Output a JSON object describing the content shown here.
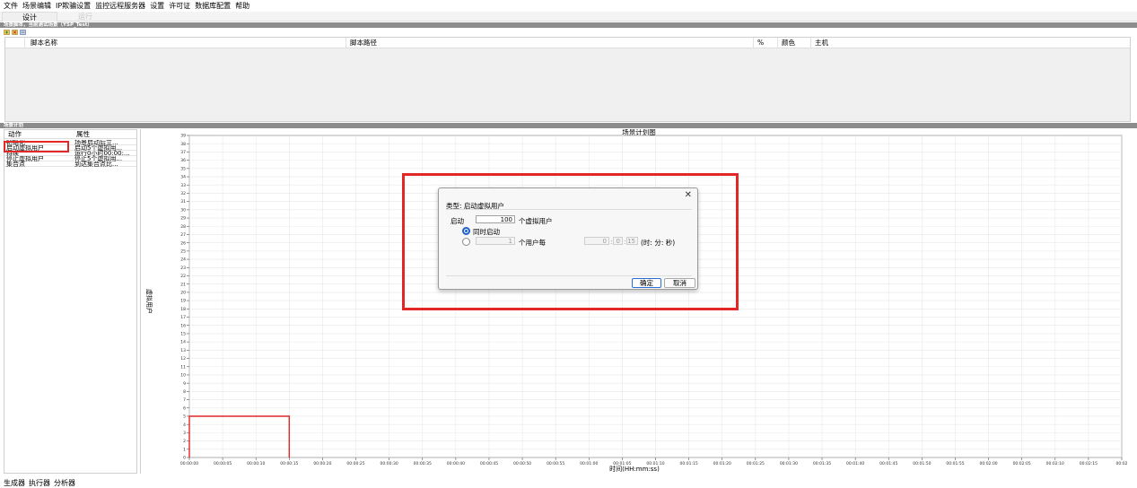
{
  "menu": [
    "文件",
    "场景编辑",
    "IP欺骗设置",
    "监控远程服务器",
    "设置",
    "许可证",
    "数据库配置",
    "帮助"
  ],
  "top_tabs": {
    "design": "设计",
    "run": "运行"
  },
  "script_section": {
    "header": "场景脚本，当前测试场景（YSP_Test）",
    "columns": [
      "脚本名称",
      "脚本路径",
      "%",
      "颜色",
      "主机"
    ]
  },
  "plan_section": {
    "header": "场景计划",
    "columns": {
      "action": "动作",
      "property": "属性"
    },
    "rows": [
      {
        "action": "初始化",
        "property": "场景启动后立..."
      },
      {
        "action": "启动虚拟用户",
        "property": "启动5个虚拟用..."
      },
      {
        "action": "持续",
        "property": "运行0小时00:00:..."
      },
      {
        "action": "停止虚拟用户",
        "property": "停止5个虚拟用..."
      },
      {
        "action": "集合点",
        "property": "到达集合点比..."
      }
    ]
  },
  "chart": {
    "title": "场景计划图",
    "ylabel": "虚拟用户",
    "xlabel": "时间(HH:mm:ss)"
  },
  "chart_data": {
    "type": "line",
    "title": "场景计划图",
    "xlabel": "时间(HH:mm:ss)",
    "ylabel": "虚拟用户",
    "ylim": [
      0,
      39
    ],
    "yticks": [
      0,
      1,
      2,
      3,
      4,
      5,
      6,
      7,
      8,
      9,
      10,
      11,
      12,
      13,
      14,
      15,
      16,
      17,
      18,
      19,
      20,
      21,
      22,
      23,
      24,
      25,
      26,
      27,
      28,
      29,
      30,
      31,
      32,
      33,
      34,
      35,
      36,
      37,
      38,
      39
    ],
    "xticks": [
      "00:00:00",
      "00:00:05",
      "00:00:10",
      "00:00:15",
      "00:00:20",
      "00:00:25",
      "00:00:30",
      "00:00:35",
      "00:00:40",
      "00:00:45",
      "00:00:50",
      "00:00:55",
      "00:01:00",
      "00:01:05",
      "00:01:10",
      "00:01:15",
      "00:01:20",
      "00:01:25",
      "00:01:30",
      "00:01:35",
      "00:01:40",
      "00:01:45",
      "00:01:50",
      "00:01:55",
      "00:02:00",
      "00:02:05",
      "00:02:10",
      "00:02:15",
      "00:02"
    ],
    "grid": true,
    "series": [
      {
        "color": "#e32727",
        "points": [
          {
            "t": "00:00:00",
            "v": 0
          },
          {
            "t": "00:00:00",
            "v": 5
          },
          {
            "t": "00:00:15",
            "v": 5
          },
          {
            "t": "00:00:15",
            "v": 0
          }
        ]
      }
    ]
  },
  "dialog": {
    "type_label": "类型: 启动虚拟用户",
    "start_label": "启动",
    "start_value": "100",
    "unit_vusers": "个虚拟用户",
    "option_simultaneous": "同时启动",
    "option_gradual_value": "1",
    "unit_per_user": "个用户每",
    "time_h": "0",
    "time_m": "0",
    "time_s": "15",
    "time_unit": "(时: 分: 秒)",
    "ok": "确定",
    "cancel": "取消"
  },
  "bottom_tabs": [
    "生成器",
    "执行器",
    "分析器"
  ],
  "colors": {
    "highlight": "#e32727",
    "header": "#8c8c8c",
    "accent": "#1e5fc9"
  }
}
